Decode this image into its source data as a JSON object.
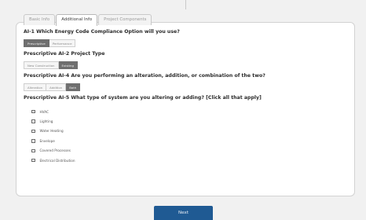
{
  "tabs": [
    {
      "label": "Basic Info",
      "active": false
    },
    {
      "label": "Additional Info",
      "active": true
    },
    {
      "label": "Project Components",
      "active": false
    }
  ],
  "questions": {
    "q1": {
      "text": "AI-1 Which Energy Code Compliance Option will you use?",
      "options": [
        "Prescriptive",
        "Performance"
      ],
      "selected": "Prescriptive"
    },
    "q2": {
      "text": "Prescriptive AI-2 Project Type",
      "options": [
        "New Construction",
        "Existing"
      ],
      "selected": "Existing"
    },
    "q3": {
      "text": "Prescriptive AI-4 Are you performing an alteration, addition, or combination of the two?",
      "options": [
        "Alteration",
        "Addition",
        "Both"
      ],
      "selected": "Both"
    },
    "q4": {
      "text": "Prescriptive AI-5 What type of system are you altering or adding? [Click all that apply]",
      "items": [
        "HVAC",
        "Lighting",
        "Water Heating",
        "Envelope",
        "Covered Processes",
        "Electrical Distribution"
      ]
    }
  },
  "next_label": "Next",
  "colors": {
    "accent": "#1f5a93",
    "selected": "#6f6f6f"
  }
}
